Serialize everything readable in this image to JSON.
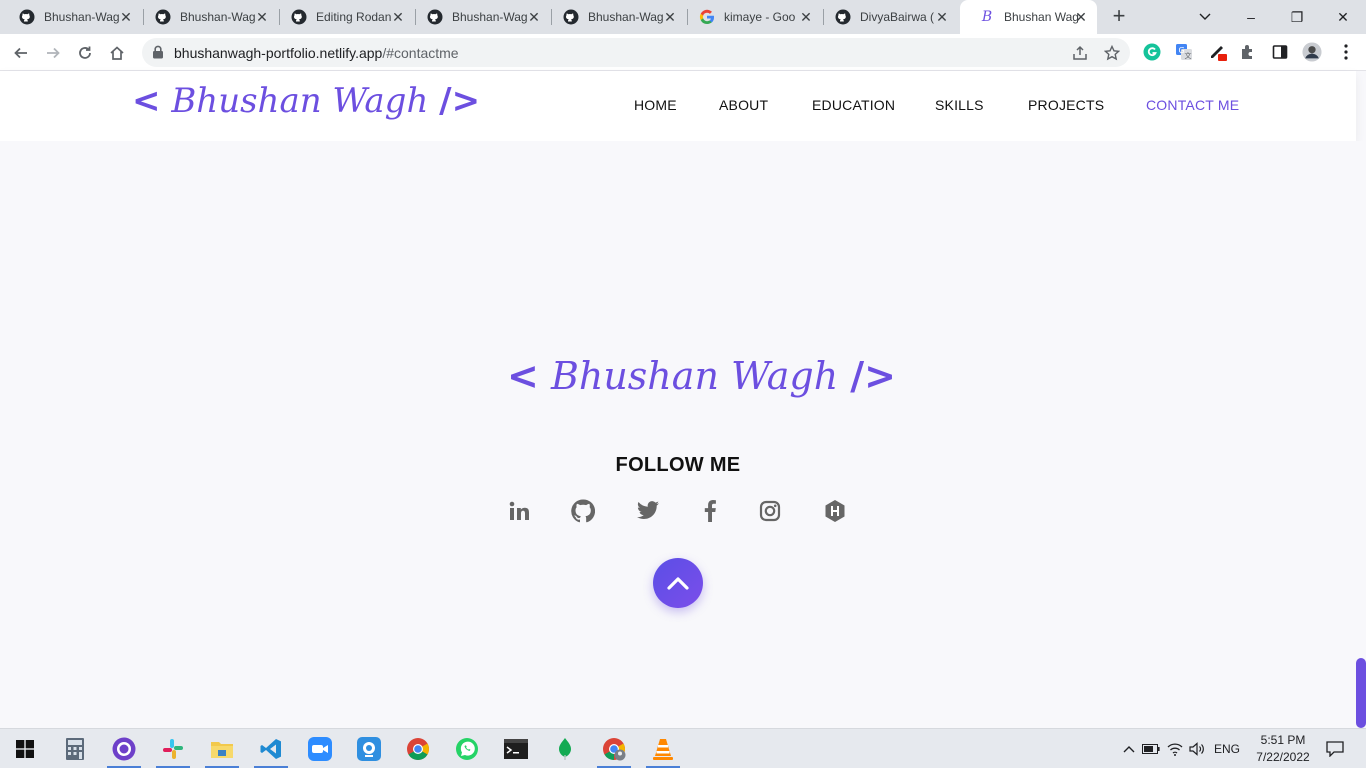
{
  "browser": {
    "tabs": [
      {
        "title": "Bhushan-Wagh",
        "icon": "github-icon"
      },
      {
        "title": "Bhushan-Wagh",
        "icon": "github-icon"
      },
      {
        "title": "Editing Rodan",
        "icon": "github-icon"
      },
      {
        "title": "Bhushan-Wagh",
        "icon": "github-icon"
      },
      {
        "title": "Bhushan-Wagh",
        "icon": "github-icon"
      },
      {
        "title": "kimaye - Goo",
        "icon": "google-icon"
      },
      {
        "title": "DivyaBairwa (",
        "icon": "github-icon"
      },
      {
        "title": "Bhushan Wag",
        "icon": "site-favicon",
        "active": true
      }
    ],
    "url_host": "bhushanwagh-portfolio.netlify.app",
    "url_path": "/#contactme",
    "window_controls": {
      "minimize": "–",
      "restore": "❐",
      "close": "✕"
    }
  },
  "site": {
    "logo": {
      "open": "<",
      "name": "Bhushan Wagh",
      "close": "/>"
    },
    "nav": [
      {
        "label": "HOME"
      },
      {
        "label": "ABOUT"
      },
      {
        "label": "EDUCATION"
      },
      {
        "label": "SKILLS"
      },
      {
        "label": "PROJECTS"
      },
      {
        "label": "CONTACT ME",
        "active": true
      }
    ],
    "footer": {
      "follow_label": "FOLLOW ME",
      "social": [
        "linkedin-icon",
        "github-icon",
        "twitter-icon",
        "facebook-icon",
        "instagram-icon",
        "hashnode-icon"
      ]
    },
    "colors": {
      "accent": "#6c4fe0",
      "icon_gray": "#666666"
    }
  },
  "taskbar": {
    "apps": [
      "start-icon",
      "calculator-icon",
      "github-desktop-icon",
      "slack-icon",
      "file-explorer-icon",
      "vscode-icon",
      "zoom-icon",
      "webcam-icon",
      "chrome-icon",
      "whatsapp-icon",
      "terminal-icon",
      "mongodb-icon",
      "chrome-profile-icon",
      "vlc-icon"
    ],
    "language": "ENG",
    "time": "5:51 PM",
    "date": "7/22/2022"
  }
}
